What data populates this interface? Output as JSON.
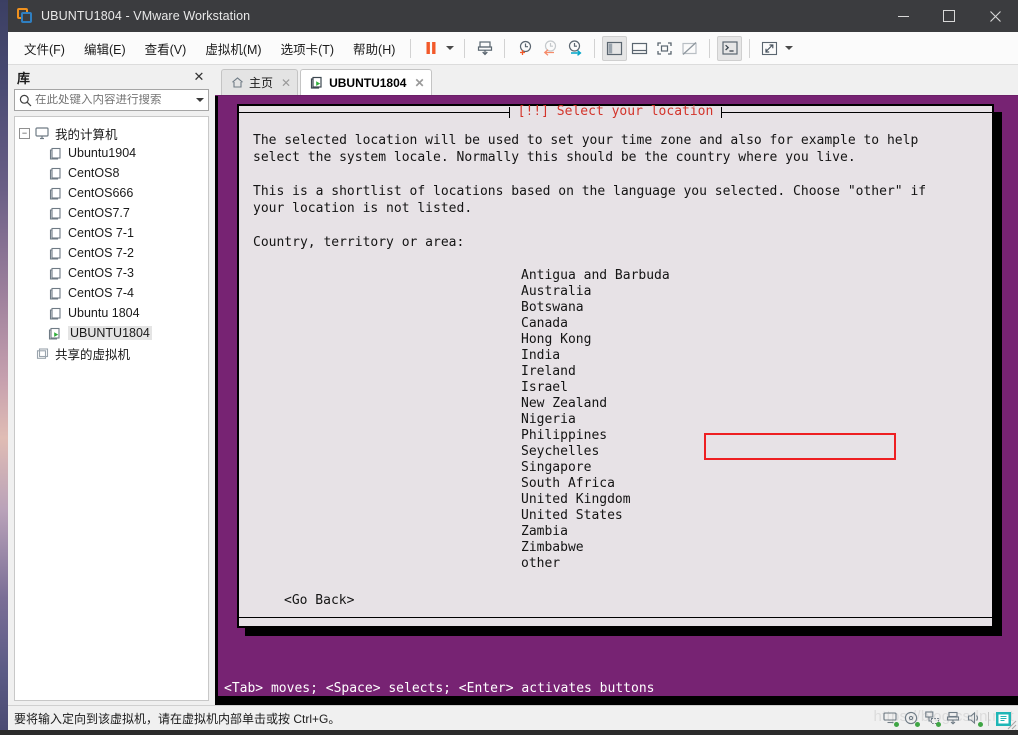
{
  "window": {
    "title": "UBUNTU1804 - VMware Workstation",
    "icon": "vmware-logo-icon",
    "controls": {
      "minimize": "—",
      "maximize": "□",
      "close": "×"
    }
  },
  "menubar": {
    "items": [
      {
        "label": "文件(F)",
        "name": "menu-file"
      },
      {
        "label": "编辑(E)",
        "name": "menu-edit"
      },
      {
        "label": "查看(V)",
        "name": "menu-view"
      },
      {
        "label": "虚拟机(M)",
        "name": "menu-vm"
      },
      {
        "label": "选项卡(T)",
        "name": "menu-tabs"
      },
      {
        "label": "帮助(H)",
        "name": "menu-help"
      }
    ],
    "toolbar_icons": [
      "pause-icon",
      "power-dropdown-caret-icon",
      "snapshot-take-icon",
      "snapshot-add-icon",
      "snapshot-revert-icon",
      "snapshot-manage-icon",
      "show-library-icon",
      "show-thumbnails-icon",
      "fullscreen-icon",
      "unity-mode-icon",
      "console-view-icon",
      "stretch-guest-icon",
      "stretch-dropdown-caret-icon"
    ]
  },
  "sidebar": {
    "title": "库",
    "close_label": "✕",
    "search": {
      "placeholder": "在此处键入内容进行搜索",
      "value": "",
      "icon": "search-icon",
      "caret": "chevron-down-icon"
    },
    "tree": {
      "root": {
        "label": "我的计算机",
        "icon": "computer-icon",
        "expander": "−"
      },
      "vms": [
        {
          "label": "Ubuntu1904",
          "icon": "vm-icon",
          "running": false
        },
        {
          "label": "CentOS8",
          "icon": "vm-icon",
          "running": false
        },
        {
          "label": "CentOS666",
          "icon": "vm-icon",
          "running": false
        },
        {
          "label": "CentOS7.7",
          "icon": "vm-icon",
          "running": false
        },
        {
          "label": "CentOS 7-1",
          "icon": "vm-icon",
          "running": false
        },
        {
          "label": "CentOS 7-2",
          "icon": "vm-icon",
          "running": false
        },
        {
          "label": "CentOS 7-3",
          "icon": "vm-icon",
          "running": false
        },
        {
          "label": "CentOS 7-4",
          "icon": "vm-icon",
          "running": false
        },
        {
          "label": "Ubuntu 1804",
          "icon": "vm-icon",
          "running": false
        },
        {
          "label": "UBUNTU1804",
          "icon": "vm-running-icon",
          "running": true
        }
      ],
      "shared": {
        "label": "共享的虚拟机",
        "icon": "shared-vm-icon"
      }
    }
  },
  "tabs": [
    {
      "label": "主页",
      "icon": "home-icon",
      "close": "✕",
      "active": false
    },
    {
      "label": "UBUNTU1804",
      "icon": "vm-running-icon",
      "close": "✕",
      "active": true
    }
  ],
  "installer": {
    "title": "[!!] Select your location",
    "title_color": "#d3342b",
    "paragraphs": [
      "The selected location will be used to set your time zone and also for example to help",
      "select the system locale. Normally this should be the country where you live.",
      "",
      "This is a shortlist of locations based on the language you selected. Choose \"other\" if",
      "your location is not listed.",
      "",
      "Country, territory or area:"
    ],
    "countries": [
      "Antigua and Barbuda",
      "Australia",
      "Botswana",
      "Canada",
      "Hong Kong",
      "India",
      "Ireland",
      "Israel",
      "New Zealand",
      "Nigeria",
      "Philippines",
      "Seychelles",
      "Singapore",
      "South Africa",
      "United Kingdom",
      "United States",
      "Zambia",
      "Zimbabwe",
      "other"
    ],
    "selected_country": "Hong Kong",
    "selected_bg": "#e03a2a",
    "selected_fg": "#ffffff",
    "go_back": "<Go Back>",
    "help_line": "<Tab> moves; <Space> selects; <Enter> activates buttons",
    "annotation": {
      "name": "red-highlight-box",
      "color": "#ee1f22",
      "target": "Hong Kong"
    },
    "console_bg": "#772373",
    "dialog_bg": "#e7e2e6"
  },
  "statusbar": {
    "text": "要将输入定向到该虚拟机，请在虚拟机内部单击或按 Ctrl+G。",
    "watermark": "https://blog.csdn.net",
    "icons": [
      "hard-disk-icon",
      "cd-dvd-icon",
      "network-icon",
      "usb-icon",
      "sound-icon",
      "printer-icon"
    ]
  }
}
